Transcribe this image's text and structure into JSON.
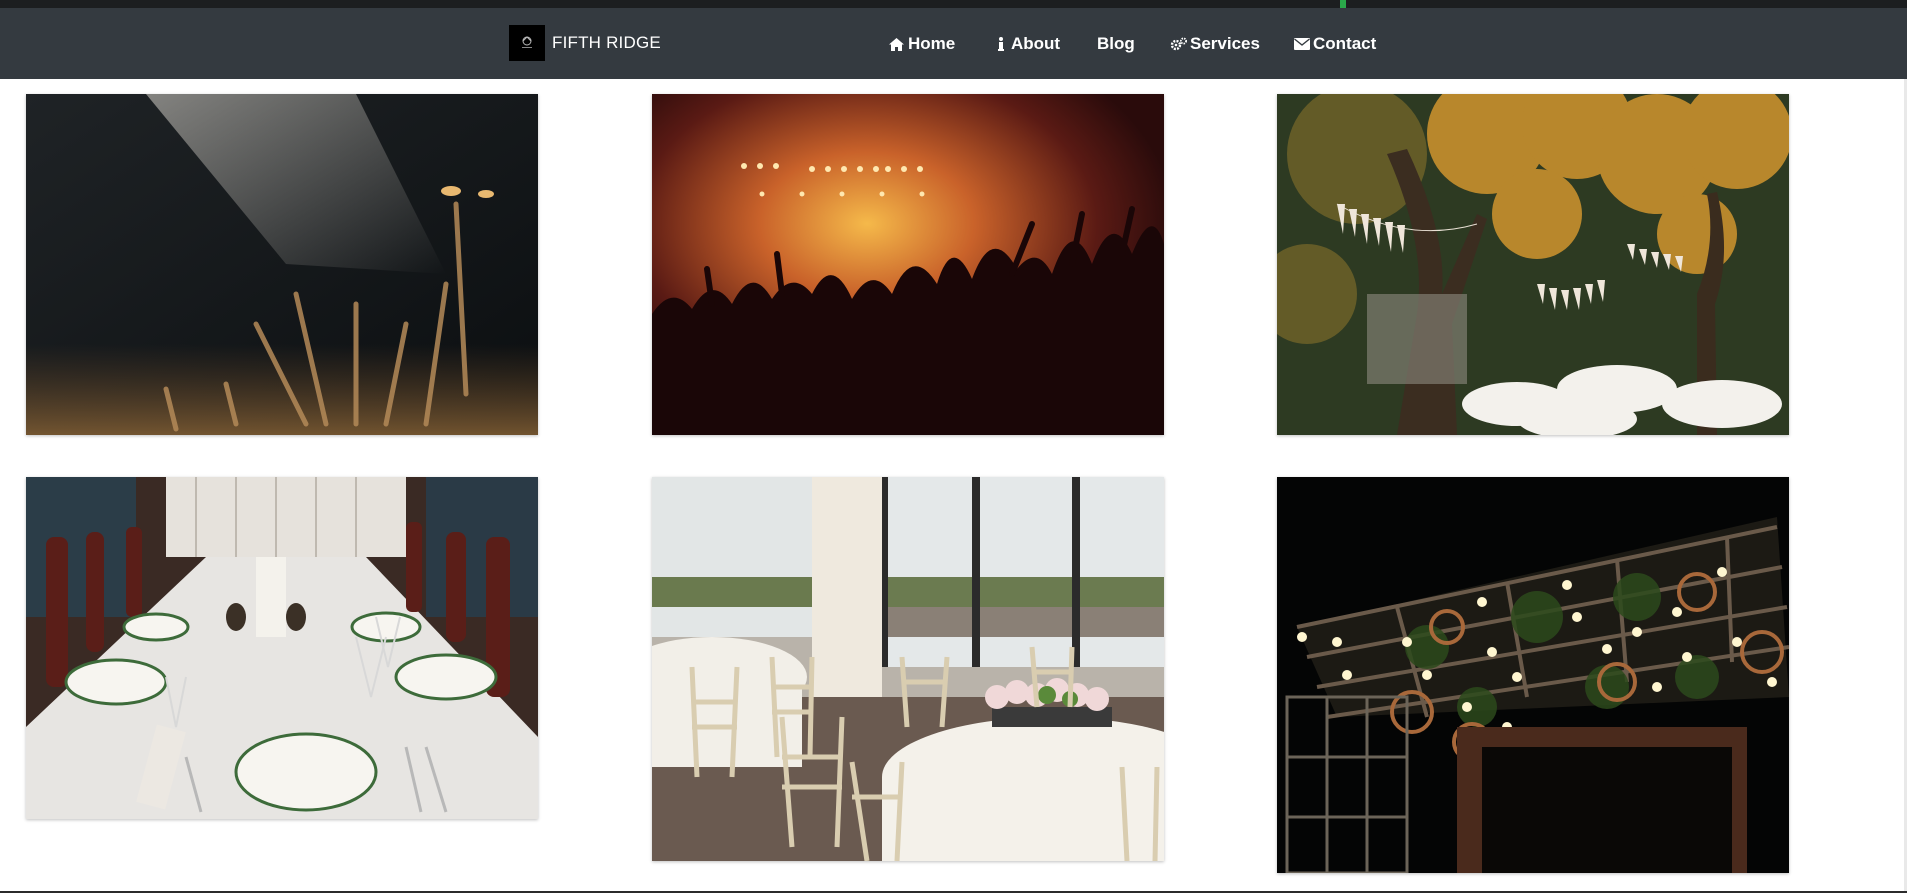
{
  "brand": {
    "name": "FIFTH RIDGE",
    "logo": "fifth-ridge-logo"
  },
  "nav": {
    "home": {
      "label": "Home",
      "icon": "home-icon"
    },
    "about": {
      "label": "About",
      "icon": "info-icon"
    },
    "blog": {
      "label": "Blog"
    },
    "services": {
      "label": "Services",
      "icon": "cogs-icon"
    },
    "contact": {
      "label": "Contact",
      "icon": "envelope-icon"
    }
  },
  "gallery": [
    {
      "subject": "concert-crowd-hands-in-light-beam"
    },
    {
      "subject": "concert-crowd-stage-lights"
    },
    {
      "subject": "outdoor-tree-bunting-wedding-tables"
    },
    {
      "subject": "holiday-dinner-table-setting"
    },
    {
      "subject": "banquet-hall-round-tables-chiavari-chairs"
    },
    {
      "subject": "string-lights-pergola-night"
    }
  ],
  "colors": {
    "navbar": "#343a40",
    "background": "#ffffff",
    "nav_text": "#ffffff"
  }
}
